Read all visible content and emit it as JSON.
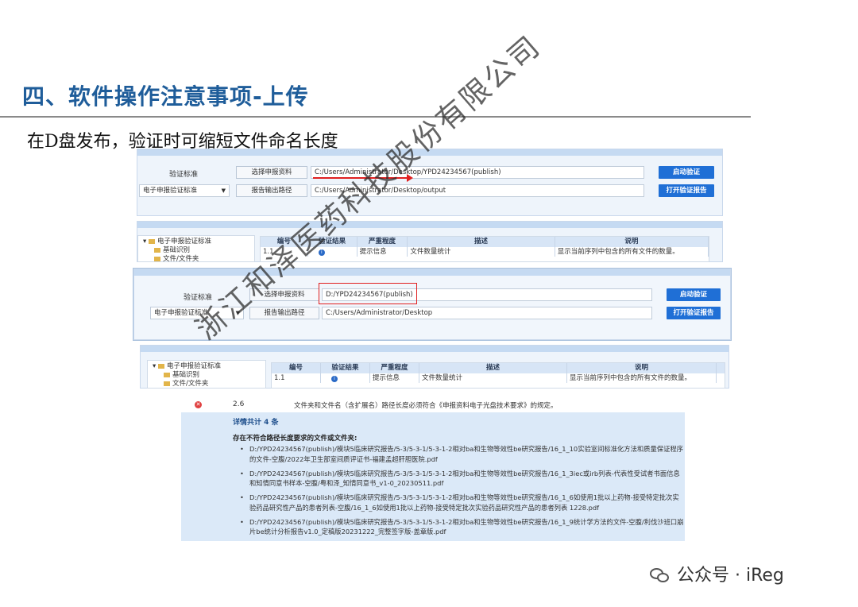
{
  "slide": {
    "title": "四、软件操作注意事项-上传",
    "subtitle": "在D盘发布，验证时可缩短文件命名长度"
  },
  "panel1": {
    "label_standard": "验证标准",
    "select_btn": "选择申报资料",
    "path_input": "C:/Users/Administrator/Desktop/YPD24234567(publish)",
    "start_btn": "启动验证",
    "dropdown": "电子申报验证标准",
    "report_btn": "报告输出路径",
    "report_path": "C:/Users/Administrator/Desktop/output",
    "open_report_btn": "打开验证报告"
  },
  "panel1_lower": {
    "tree": [
      "电子申报验证标准",
      "基础识别",
      "文件/文件夹"
    ],
    "headers": [
      "编号",
      "验证结果",
      "严重程度",
      "描述",
      "说明"
    ],
    "row": {
      "num": "1.1",
      "severity": "提示信息",
      "desc": "文件数量统计",
      "note": "显示当前序列中包含的所有文件的数量。"
    }
  },
  "panel2": {
    "label_standard": "验证标准",
    "select_btn": "选择申报资料",
    "path_input": "D:/YPD24234567(publish)",
    "start_btn": "启动验证",
    "dropdown": "电子申报验证标准",
    "report_btn": "报告输出路径",
    "report_path": "C:/Users/Administrator/Desktop",
    "open_report_btn": "打开验证报告"
  },
  "panel2_lower": {
    "tree": [
      "电子申报验证标准",
      "基础识别",
      "文件/文件夹"
    ],
    "headers": [
      "编号",
      "验证结果",
      "严重程度",
      "描述",
      "说明"
    ],
    "row": {
      "num": "1.1",
      "severity": "提示信息",
      "desc": "文件数量统计",
      "note": "显示当前序列中包含的所有文件的数量。"
    }
  },
  "detail": {
    "num": "2.6",
    "desc": "文件夹和文件名（含扩展名）路径长度必须符合《申报资料电子光盘技术要求》的规定。",
    "count": "详情共计 4 条",
    "subhead": "存在不符合路径长度要求的文件或文件夹:",
    "items": [
      "D:/YPD24234567(publish)/模块5临床研究报告/5-3/5-3-1/5-3-1-2相对ba和生物等效性be研究报告/16_1_10实验室间标准化方法和质量保证程序的文件-空腹/2022年卫生部室间质评证书-福建孟超肝胆医院.pdf",
      "D:/YPD24234567(publish)/模块5临床研究报告/5-3/5-3-1/5-3-1-2相对ba和生物等效性be研究报告/16_1_3iec或irb列表-代表性受试者书面信息和知情同意书样本-空腹/粤和泽_知情同意书_v1-0_20230511.pdf",
      "D:/YPD24234567(publish)/模块5临床研究报告/5-3/5-3-1/5-3-1-2相对ba和生物等效性be研究报告/16_1_6如使用1批以上药物-接受特定批次实验药品研究性产品的患者列表-空腹/16_1_6如使用1批以上药物-接受特定批次实验药品研究性产品的患者列表 1228.pdf",
      "D:/YPD24234567(publish)/模块5临床研究报告/5-3/5-3-1/5-3-1-2相对ba和生物等效性be研究报告/16_1_9统计学方法的文件-空腹/利伐沙班口崩片be统计分析报告v1.0_定稿版20231222_完整签字版-盖章版.pdf"
    ]
  },
  "watermark": "浙江和泽医药科技股份有限公司",
  "footer": {
    "brand": "公众号 · iReg"
  },
  "colors": {
    "title": "#1f5d9a",
    "accent_blue": "#1f6fd6",
    "highlight_red": "#e02020"
  }
}
